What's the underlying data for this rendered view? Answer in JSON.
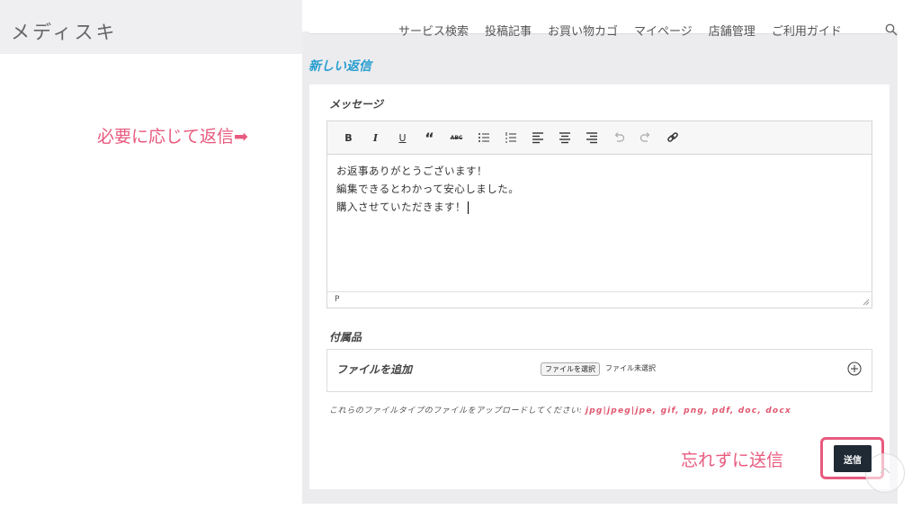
{
  "header": {
    "logo": "メディスキ",
    "nav": [
      "サービス検索",
      "投稿記事",
      "お買い物カゴ",
      "マイページ",
      "店舗管理",
      "ご利用ガイド"
    ]
  },
  "main": {
    "title": "新しい返信",
    "message_label": "メッセージ",
    "toolbar": [
      "B",
      "I",
      "U",
      "“",
      "ABC"
    ],
    "message_lines": [
      "お返事ありがとうございます！",
      "編集できるとわかって安心しました。",
      "購入させていただきます！"
    ],
    "status_path": "P",
    "attachments_label": "付属品",
    "add_file_label": "ファイルを追加",
    "file_button": "ファイルを選択",
    "file_status": "ファイル未選択",
    "hint_text": "これらのファイルタイプのファイルをアップロードしてください:",
    "hint_types": "jpg|jpeg|jpe, gif, png, pdf, doc, docx",
    "send_label": "送信"
  },
  "annotations": {
    "reply_note": "必要に応じて返信➡",
    "send_note": "忘れずに送信"
  },
  "colors": {
    "annotation": "#e85a7e",
    "title": "#2a9fd0",
    "send_button": "#1f2a35"
  }
}
